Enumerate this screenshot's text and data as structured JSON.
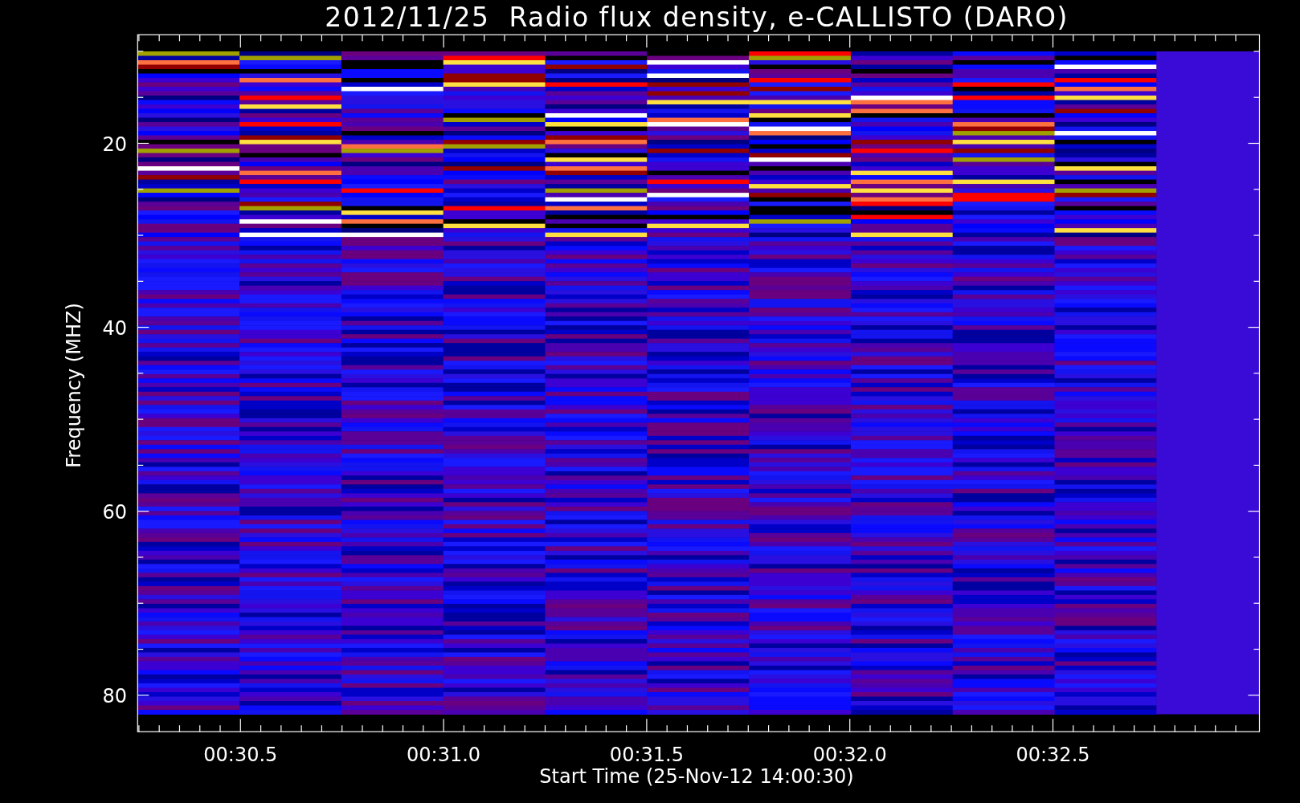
{
  "title": "2012/11/25  Radio flux density, e-CALLISTO (DARO)",
  "y_axis": {
    "label": "Frequency (MHZ)",
    "ticks": [
      "20",
      "40",
      "60",
      "80"
    ]
  },
  "x_axis": {
    "label": "Start Time (25-Nov-12 14:00:30)",
    "ticks": [
      "00:30.5",
      "00:31.0",
      "00:31.5",
      "00:32.0",
      "00:32.5"
    ]
  }
}
